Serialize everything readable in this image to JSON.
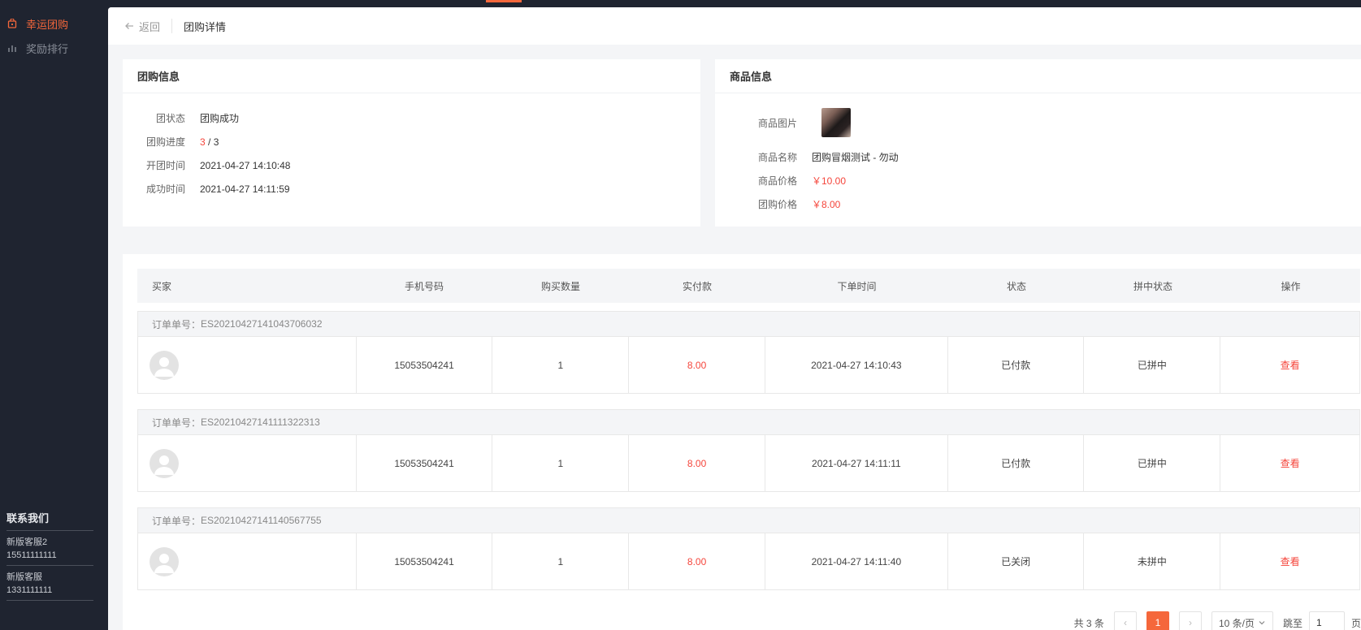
{
  "sidebar": {
    "items": [
      {
        "label": "幸运团购",
        "icon": "bag-icon",
        "active": true
      },
      {
        "label": "奖励排行",
        "icon": "bar-chart-icon",
        "active": false
      }
    ],
    "contact": {
      "title": "联系我们",
      "entries": [
        {
          "name": "新版客服2",
          "phone": "15511111111"
        },
        {
          "name": "新版客服",
          "phone": "1331111111"
        }
      ]
    }
  },
  "header": {
    "back_label": "返回",
    "title": "团购详情"
  },
  "group_info": {
    "title": "团购信息",
    "status_label": "团状态",
    "status_value": "团购成功",
    "progress_label": "团购进度",
    "progress_current": "3",
    "progress_sep": " / ",
    "progress_total": "3",
    "open_label": "开团时间",
    "open_value": "2021-04-27 14:10:48",
    "success_label": "成功时间",
    "success_value": "2021-04-27 14:11:59"
  },
  "product_info": {
    "title": "商品信息",
    "image_label": "商品图片",
    "name_label": "商品名称",
    "name_value": "团购冒烟测试 - 勿动",
    "price_label": "商品价格",
    "price_value": "￥10.00",
    "group_price_label": "团购价格",
    "group_price_value": "￥8.00"
  },
  "table": {
    "headers": [
      "买家",
      "手机号码",
      "购买数量",
      "实付款",
      "下单时间",
      "状态",
      "拼中状态",
      "操作"
    ],
    "order_prefix": "订单单号：",
    "rows": [
      {
        "order_no": "ES20210427141043706032",
        "phone": "15053504241",
        "qty": "1",
        "paid": "8.00",
        "time": "2021-04-27 14:10:43",
        "status": "已付款",
        "win": "已拼中",
        "action": "查看"
      },
      {
        "order_no": "ES20210427141111322313",
        "phone": "15053504241",
        "qty": "1",
        "paid": "8.00",
        "time": "2021-04-27 14:11:11",
        "status": "已付款",
        "win": "已拼中",
        "action": "查看"
      },
      {
        "order_no": "ES20210427141140567755",
        "phone": "15053504241",
        "qty": "1",
        "paid": "8.00",
        "time": "2021-04-27 14:11:40",
        "status": "已关闭",
        "win": "未拼中",
        "action": "查看"
      }
    ]
  },
  "pager": {
    "total": "共 3 条",
    "prev": "‹",
    "current": "1",
    "next": "›",
    "size": "10 条/页",
    "jump_label": "跳至",
    "jump_value": "1",
    "page_suffix": "页"
  },
  "colors": {
    "accent": "#f5673b",
    "price_red": "#f5453b",
    "sidebar_bg": "#1f2430"
  }
}
